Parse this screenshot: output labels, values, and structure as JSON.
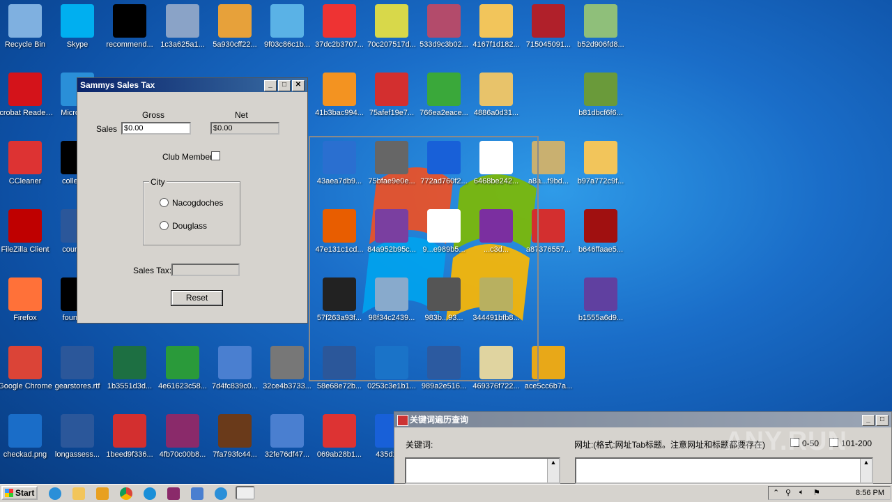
{
  "desktop_icons": [
    {
      "label": "Recycle Bin",
      "icon": "recycle-bin-icon",
      "color": "#7fb0e0"
    },
    {
      "label": "Skype",
      "icon": "skype-icon",
      "color": "#00aff0"
    },
    {
      "label": "recommend...",
      "icon": "black-file-icon",
      "color": "#000000"
    },
    {
      "label": "1c3a625a1...",
      "icon": "qr-image-icon",
      "color": "#8aa3c7"
    },
    {
      "label": "5a930cff22...",
      "icon": "package-icon",
      "color": "#e7a13a"
    },
    {
      "label": "9f03c86c1b...",
      "icon": "media-disc-icon",
      "color": "#5ab2e6"
    },
    {
      "label": "37dc2b3707...",
      "icon": "color-blocks-icon",
      "color": "#e33"
    },
    {
      "label": "70c207517d...",
      "icon": "usb-device-icon",
      "color": "#d8d84a"
    },
    {
      "label": "533d9c3b02...",
      "icon": "pattern-image-icon",
      "color": "#b34b6b"
    },
    {
      "label": "4167f1d182...",
      "icon": "folder-icon",
      "color": "#f2c55b"
    },
    {
      "label": "715045091...",
      "icon": "pdf-box-icon",
      "color": "#b0202a"
    },
    {
      "label": "b52d906fd8...",
      "icon": "recycle-bin-full-icon",
      "color": "#8fbf7a"
    },
    {
      "label": "Acrobat Reader DC",
      "icon": "acrobat-icon",
      "color": "#d4131a"
    },
    {
      "label": "Microso...",
      "icon": "edge-icon",
      "color": "#2a8fd8"
    },
    {
      "label": "41b3bac994...",
      "icon": "orange-box-icon",
      "color": "#f39321"
    },
    {
      "label": "75afef19e7...",
      "icon": "pdf-file-icon",
      "color": "#d32f2f"
    },
    {
      "label": "766ea2eace...",
      "icon": "sync-arrows-icon",
      "color": "#3aa83a"
    },
    {
      "label": "4886a0d31...",
      "icon": "book-icon",
      "color": "#e8c36a"
    },
    {
      "label": "b81dbcf6f6...",
      "icon": "image-edit-icon",
      "color": "#6a9a3a"
    },
    {
      "label": "CCleaner",
      "icon": "ccleaner-icon",
      "color": "#d33"
    },
    {
      "label": "college...",
      "icon": "black-file-icon",
      "color": "#000000"
    },
    {
      "label": "43aea7db9...",
      "icon": "network-globe-icon",
      "color": "#2a6fd0"
    },
    {
      "label": "75bfae9e0e...",
      "icon": "setup-icon",
      "color": "#666666"
    },
    {
      "label": "772ad760f2...",
      "icon": "clapper-icon",
      "color": "#1860d8"
    },
    {
      "label": "6468be242...",
      "icon": "window-icon",
      "color": "#ffffff"
    },
    {
      "label": "a8a...f9bd...",
      "icon": "scanner-icon",
      "color": "#c9b070"
    },
    {
      "label": "b97a772c9f...",
      "icon": "folder-icon",
      "color": "#f2c55b"
    },
    {
      "label": "FileZilla Client",
      "icon": "filezilla-icon",
      "color": "#bf0000"
    },
    {
      "label": "council...",
      "icon": "word-doc-icon",
      "color": "#2b579a"
    },
    {
      "label": "47e131c1cd...",
      "icon": "firefox-old-icon",
      "color": "#e85d00"
    },
    {
      "label": "84a952b95c...",
      "icon": "advanced-unlock-icon",
      "color": "#7a3fa0"
    },
    {
      "label": "9...e989b5...",
      "icon": "barcode-icon",
      "color": "#ffffff"
    },
    {
      "label": "...c3d...",
      "icon": "yahoo-messenger-icon",
      "color": "#7b2fa0"
    },
    {
      "label": "a87376557...",
      "icon": "pdf-file-icon",
      "color": "#d32f2f"
    },
    {
      "label": "b646ffaae5...",
      "icon": "red-noise-icon",
      "color": "#a01010"
    },
    {
      "label": "Firefox",
      "icon": "firefox-icon",
      "color": "#ff7139"
    },
    {
      "label": "founda...",
      "icon": "black-file-icon",
      "color": "#000000"
    },
    {
      "label": "57f263a93f...",
      "icon": "id-card-icon",
      "color": "#222222"
    },
    {
      "label": "98f34c2439...",
      "icon": "installer-disc-icon",
      "color": "#8ac"
    },
    {
      "label": "983b...93...",
      "icon": "camera-search-icon",
      "color": "#555555"
    },
    {
      "label": "344491bfb8...",
      "icon": "qr-image-icon",
      "color": "#b8b060"
    },
    {
      "label": "b1555a6d9...",
      "icon": "2015-icon",
      "color": "#6040a0"
    },
    {
      "label": "Google Chrome",
      "icon": "chrome-icon",
      "color": "#db4437"
    },
    {
      "label": "gearstores.rtf",
      "icon": "word-doc-icon",
      "color": "#2b579a"
    },
    {
      "label": "1b3551d3d...",
      "icon": "xlsx-icon",
      "color": "#1d6f42"
    },
    {
      "label": "4e61623c58...",
      "icon": "green-image-icon",
      "color": "#2a9a3a"
    },
    {
      "label": "7d4fc839c0...",
      "icon": "window-shield-icon",
      "color": "#4a7fd0"
    },
    {
      "label": "32ce4b3733...",
      "icon": "laptop-icon",
      "color": "#777777"
    },
    {
      "label": "58e68e72b...",
      "icon": "word-doc-icon",
      "color": "#2b579a"
    },
    {
      "label": "0253c3e1b1...",
      "icon": "shield-monitor-icon",
      "color": "#1a73c8"
    },
    {
      "label": "989a2e516...",
      "icon": "monitor-search-icon",
      "color": "#2c5aa0"
    },
    {
      "label": "469376f722...",
      "icon": "skull-icon",
      "color": "#e0d4a0"
    },
    {
      "label": "ace5cc6b7a...",
      "icon": "key-icon",
      "color": "#e8a818"
    },
    {
      "label": "checkad.png",
      "icon": "blank-image-icon",
      "color": "#1a6dc8"
    },
    {
      "label": "longassess...",
      "icon": "word-doc-icon",
      "color": "#2b579a"
    },
    {
      "label": "1beed9f336...",
      "icon": "pdf-file-icon",
      "color": "#d32f2f"
    },
    {
      "label": "4fb70c00b8...",
      "icon": "winrar-icon",
      "color": "#8a2a6a"
    },
    {
      "label": "7fa793fc44...",
      "icon": "books-icon",
      "color": "#6a3a1a"
    },
    {
      "label": "32fe76df47...",
      "icon": "window-shield-icon",
      "color": "#4a7fd0"
    },
    {
      "label": "069ab28b1...",
      "icon": "installer-shield-icon",
      "color": "#d33"
    },
    {
      "label": "435d1a...",
      "icon": "clapper-icon",
      "color": "#1860d8"
    }
  ],
  "sammys": {
    "title": "Sammys Sales Tax",
    "gross_label": "Gross",
    "net_label": "Net",
    "sales_label": "Sales",
    "sales_value": "$0.00",
    "net_value": "$0.00",
    "club_label": "Club Member",
    "city_label": "City",
    "city_options": [
      "Nacogdoches",
      "Douglass"
    ],
    "tax_label": "Sales Tax:",
    "tax_value": "",
    "reset_label": "Reset"
  },
  "keyword_window": {
    "title": "关键词遍历查询",
    "keyword_label": "关键词:",
    "url_label": "网址:(格式:网址Tab标题。注意网址和标题都要存在)",
    "option1": "0-50",
    "option2": "101-200"
  },
  "taskbar": {
    "start_label": "Start",
    "clock": "8:56 PM"
  },
  "watermark": "ANY.RUN"
}
